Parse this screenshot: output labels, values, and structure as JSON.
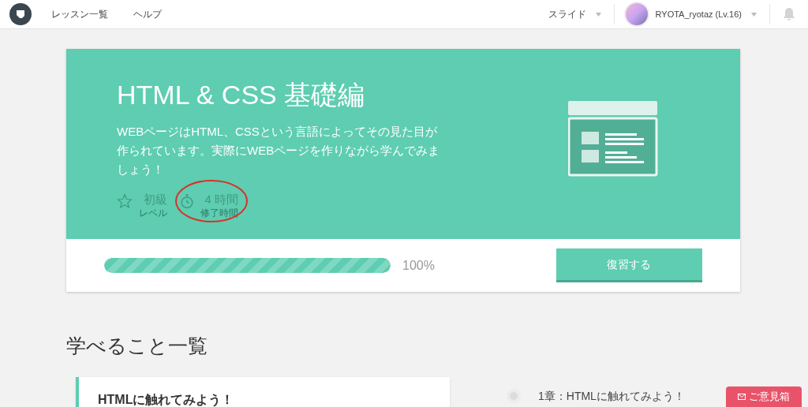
{
  "nav": {
    "links": [
      "レッスン一覧",
      "ヘルプ"
    ],
    "mode": "スライド",
    "user": "RYOTA_ryotaz (Lv.16)"
  },
  "course": {
    "title": "HTML & CSS 基礎編",
    "description": "WEBページはHTML、CSSという言語によってその見た目が作られています。実際にWEBページを作りながら学んでみましょう！",
    "stats": [
      {
        "kind": "level",
        "value": "初級",
        "label": "レベル"
      },
      {
        "kind": "time",
        "value": "4 時間",
        "label": "修了時間"
      }
    ],
    "progress": {
      "level": 1,
      "reading": "100%"
    },
    "button": "復習する"
  },
  "section_title": "学べること一覧",
  "chapter_card": {
    "title": "HTMLに触れてみよう！"
  },
  "chapters": [
    {
      "label": "1章：HTMLに触れてみよう！",
      "done": false
    }
  ],
  "feedback": "ご意見箱"
}
